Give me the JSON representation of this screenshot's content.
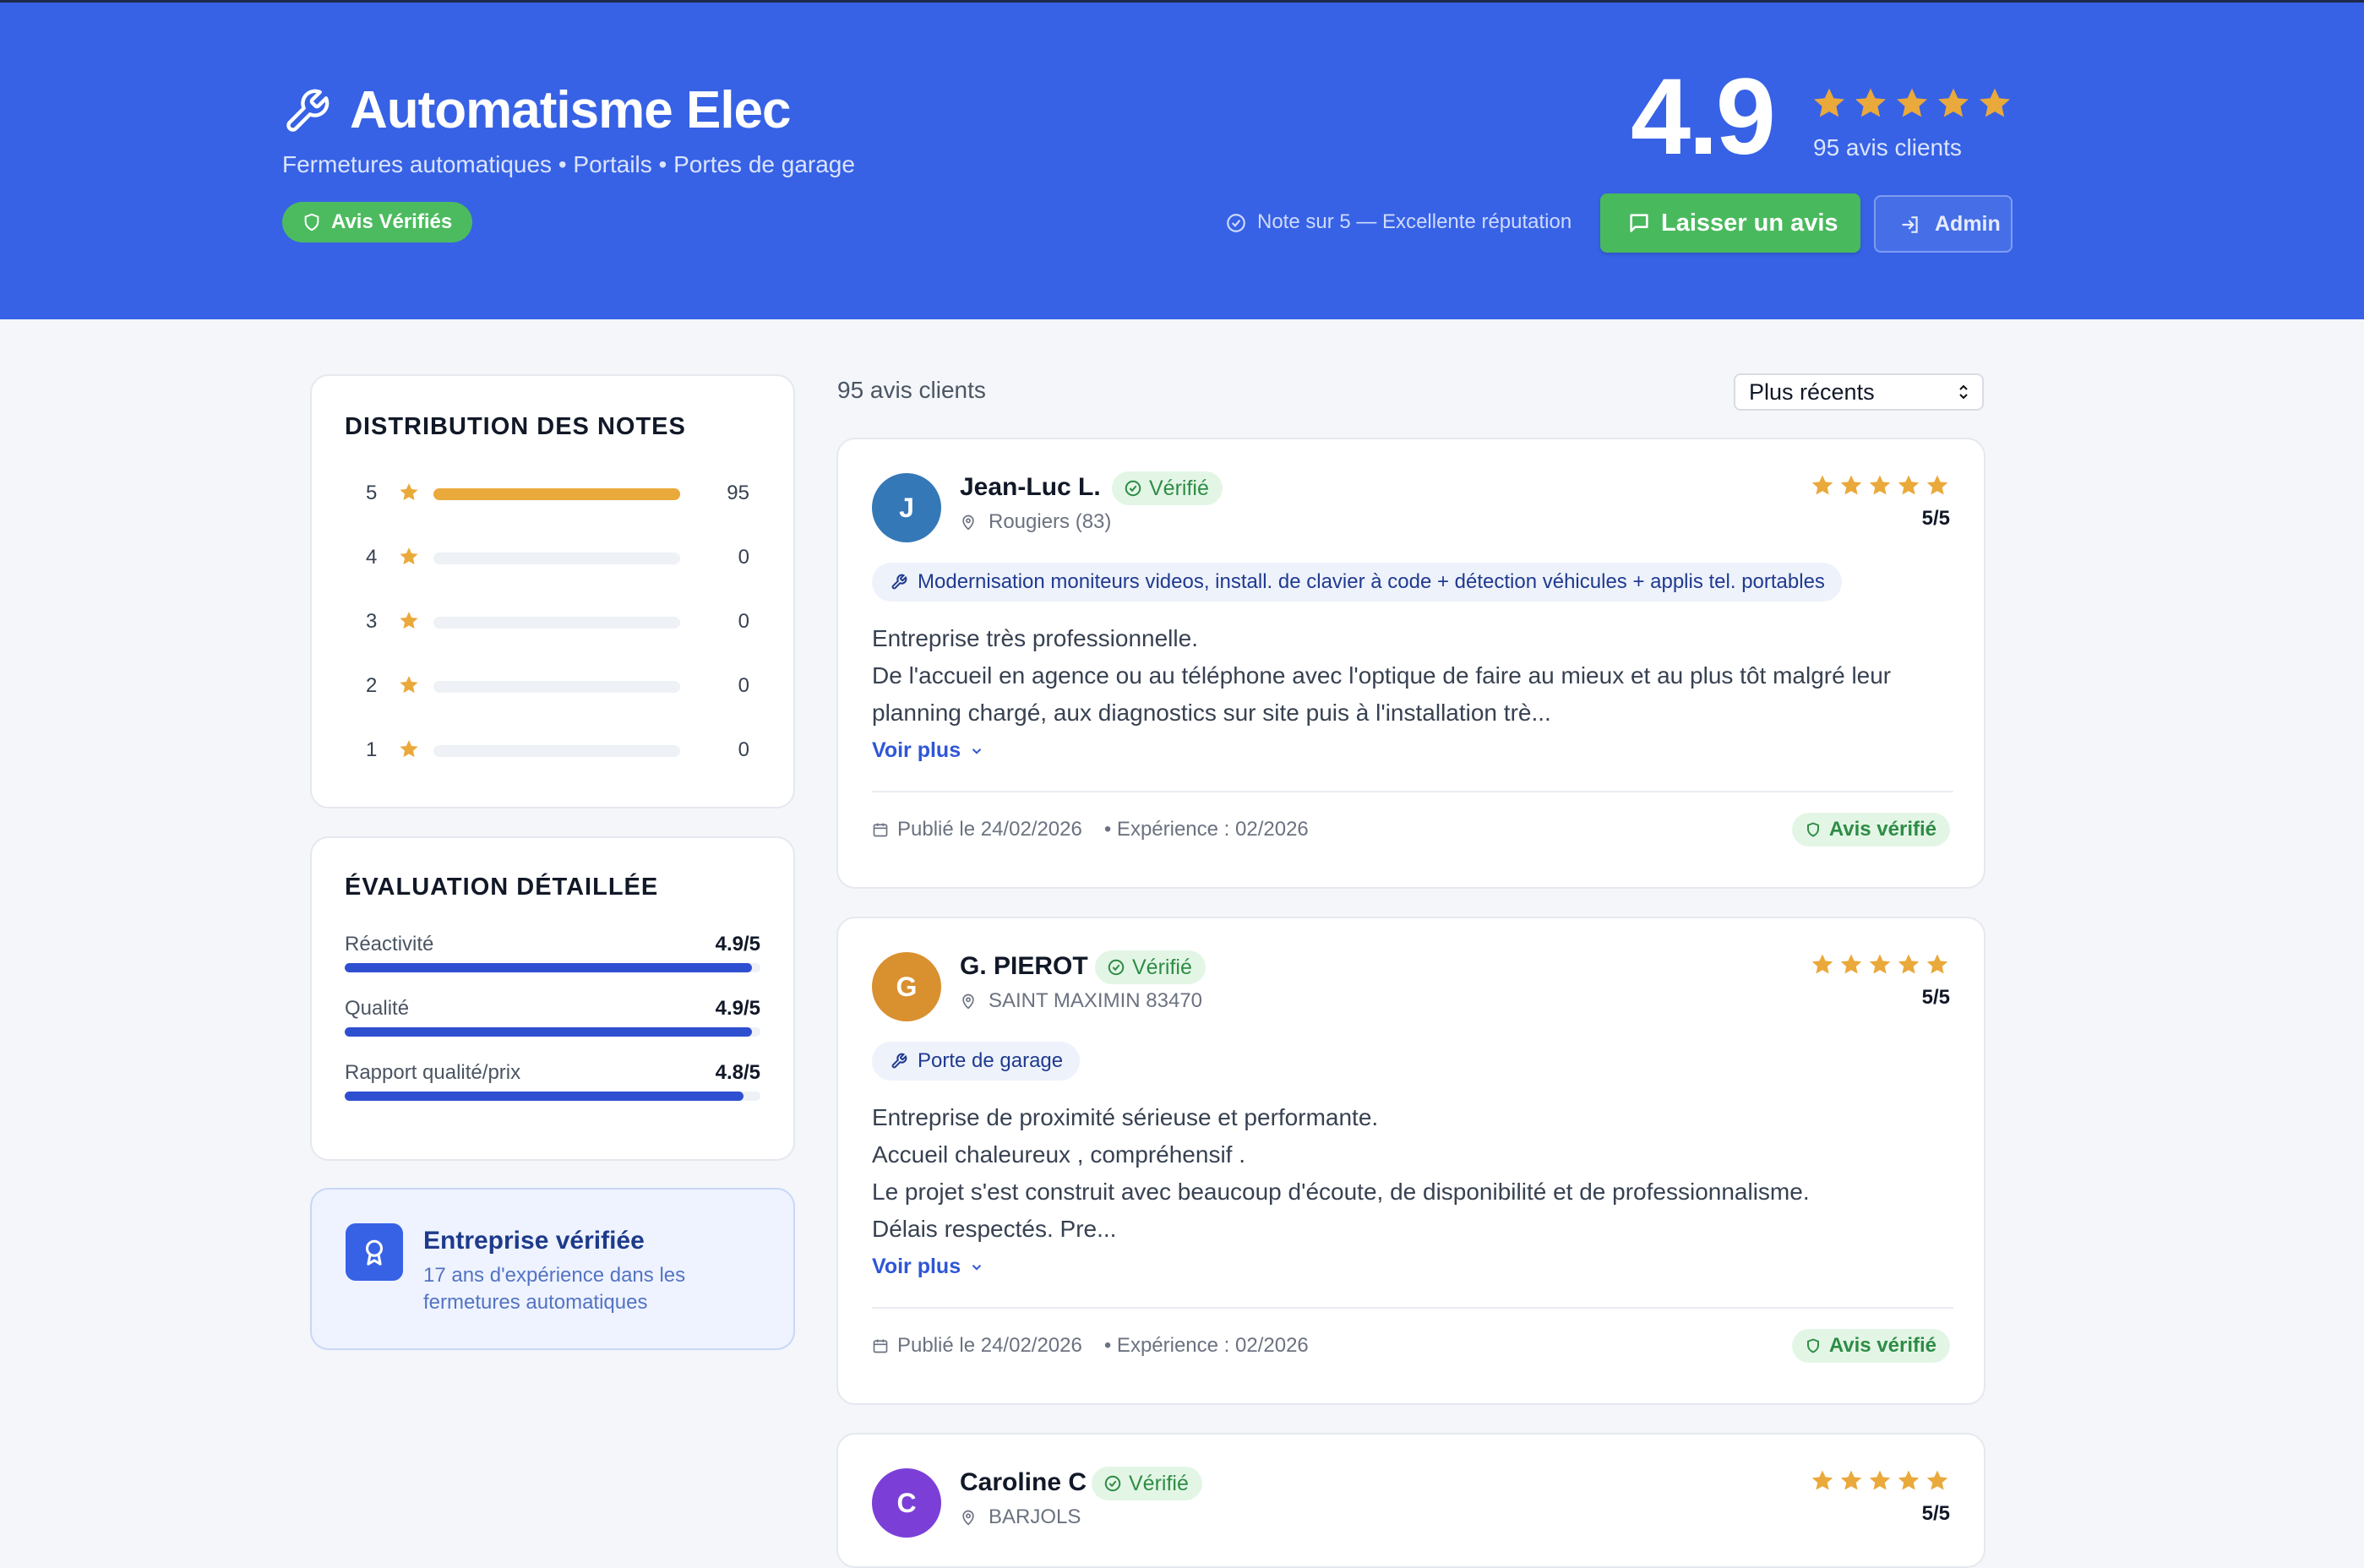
{
  "header": {
    "title": "Automatisme Elec",
    "subtitle": "Fermetures automatiques • Portails • Portes de garage",
    "verified_badge": "Avis Vérifiés",
    "score": "4.9",
    "stars": 5,
    "reviews_count": "95 avis clients",
    "note": "Note sur 5 — Excellente réputation",
    "leave_review": "Laisser un avis",
    "admin": "Admin"
  },
  "colors": {
    "primary": "#3762e5",
    "success": "#49b95d",
    "star": "#eaa93b",
    "bar_blue": "#2f4fd1"
  },
  "distribution": {
    "title": "DISTRIBUTION DES NOTES",
    "rows": [
      {
        "stars": "5",
        "count": "95",
        "fraction": 1.0
      },
      {
        "stars": "4",
        "count": "0",
        "fraction": 0
      },
      {
        "stars": "3",
        "count": "0",
        "fraction": 0
      },
      {
        "stars": "2",
        "count": "0",
        "fraction": 0
      },
      {
        "stars": "1",
        "count": "0",
        "fraction": 0
      }
    ]
  },
  "evaluation": {
    "title": "ÉVALUATION DÉTAILLÉE",
    "rows": [
      {
        "label": "Réactivité",
        "value": "4.9/5",
        "fraction": 0.98
      },
      {
        "label": "Qualité",
        "value": "4.9/5",
        "fraction": 0.98
      },
      {
        "label": "Rapport qualité/prix",
        "value": "4.8/5",
        "fraction": 0.96
      }
    ]
  },
  "company": {
    "title": "Entreprise vérifiée",
    "description": "17 ans d'expérience dans les fermetures automatiques"
  },
  "list": {
    "count": "95 avis clients",
    "sort": "Plus récents"
  },
  "reviews": [
    {
      "initial": "J",
      "avatar_color": "#3478b8",
      "name": "Jean-Luc L.",
      "verified": "Vérifié",
      "location": "Rougiers (83)",
      "rating": 5,
      "score": "5/5",
      "service": "Modernisation moniteurs videos, install. de clavier à code + détection véhicules + applis tel. portables",
      "text": [
        "Entreprise très professionnelle.",
        "De l'accueil en agence ou au téléphone avec l'optique de faire au mieux et au plus tôt malgré leur",
        "planning chargé, aux diagnostics sur site puis à l'installation trè..."
      ],
      "more": "Voir plus",
      "published": "Publié le 24/02/2026",
      "experience": "• Expérience : 02/2026",
      "avis_ok": "Avis vérifié"
    },
    {
      "initial": "G",
      "avatar_color": "#d9902f",
      "name": "G. PIEROT",
      "verified": "Vérifié",
      "location": "SAINT MAXIMIN 83470",
      "rating": 5,
      "score": "5/5",
      "service": "Porte de garage",
      "text": [
        "Entreprise de proximité sérieuse et performante.",
        "Accueil chaleureux , compréhensif .",
        "Le projet s'est construit avec beaucoup d'écoute, de disponibilité et de professionnalisme.",
        "Délais respectés. Pre..."
      ],
      "more": "Voir plus",
      "published": "Publié le 24/02/2026",
      "experience": "• Expérience : 02/2026",
      "avis_ok": "Avis vérifié"
    },
    {
      "initial": "C",
      "avatar_color": "#7b3fd8",
      "name": "Caroline C",
      "verified": "Vérifié",
      "location": "BARJOLS",
      "rating": 5,
      "score": "5/5"
    }
  ]
}
